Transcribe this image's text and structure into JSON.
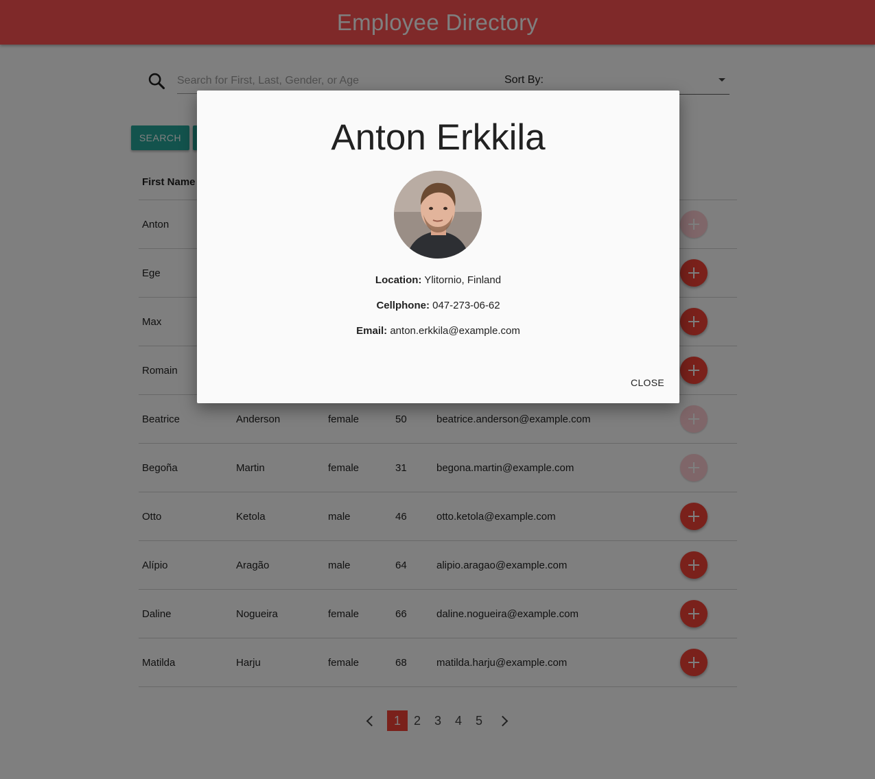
{
  "header": {
    "title": "Employee Directory"
  },
  "search": {
    "placeholder": "Search for First, Last, Gender, or Age",
    "value": ""
  },
  "sort": {
    "label": "Sort By:"
  },
  "buttons": {
    "search_label": "SEARCH",
    "second_label": ""
  },
  "table": {
    "headers": [
      "First Name",
      "",
      "",
      "",
      "",
      ""
    ],
    "rows": [
      {
        "first": "Anton",
        "last": "",
        "gender": "",
        "age": "",
        "email": "",
        "fab_dim": true
      },
      {
        "first": "Ege",
        "last": "",
        "gender": "",
        "age": "",
        "email": "",
        "fab_dim": false
      },
      {
        "first": "Max",
        "last": "",
        "gender": "",
        "age": "",
        "email": "",
        "fab_dim": false
      },
      {
        "first": "Romain",
        "last": "",
        "gender": "",
        "age": "",
        "email": "",
        "fab_dim": false
      },
      {
        "first": "Beatrice",
        "last": "Anderson",
        "gender": "female",
        "age": "50",
        "email": "beatrice.anderson@example.com",
        "fab_dim": true
      },
      {
        "first": "Begoña",
        "last": "Martin",
        "gender": "female",
        "age": "31",
        "email": "begona.martin@example.com",
        "fab_dim": true
      },
      {
        "first": "Otto",
        "last": "Ketola",
        "gender": "male",
        "age": "46",
        "email": "otto.ketola@example.com",
        "fab_dim": false
      },
      {
        "first": "Alípio",
        "last": "Aragão",
        "gender": "male",
        "age": "64",
        "email": "alipio.aragao@example.com",
        "fab_dim": false
      },
      {
        "first": "Daline",
        "last": "Nogueira",
        "gender": "female",
        "age": "66",
        "email": "daline.nogueira@example.com",
        "fab_dim": false
      },
      {
        "first": "Matilda",
        "last": "Harju",
        "gender": "female",
        "age": "68",
        "email": "matilda.harju@example.com",
        "fab_dim": false
      }
    ]
  },
  "pagination": {
    "pages": [
      "1",
      "2",
      "3",
      "4",
      "5"
    ],
    "current": "1"
  },
  "modal": {
    "name": "Anton Erkkila",
    "location_label": "Location:",
    "location": "Ylitornio, Finland",
    "cellphone_label": "Cellphone:",
    "cellphone": "047-273-06-62",
    "email_label": "Email:",
    "email": "anton.erkkila@example.com",
    "close_label": "CLOSE"
  },
  "colors": {
    "appbar": "#ff5252",
    "button": "#26a69a",
    "accent": "#f44336"
  }
}
